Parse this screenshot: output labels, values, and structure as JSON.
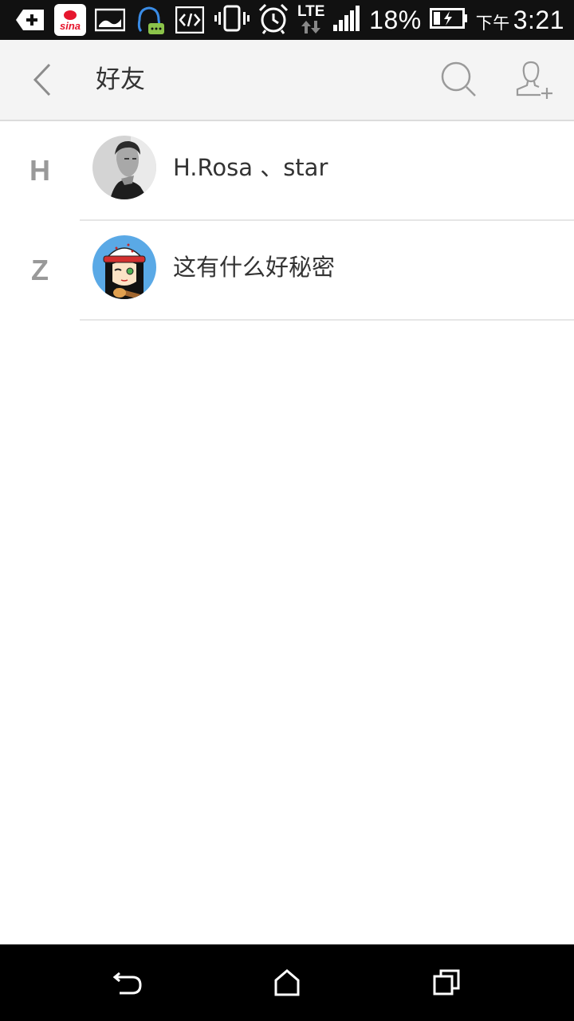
{
  "status_bar": {
    "notification_icons": [
      "add-icon",
      "sina-weibo-icon",
      "image-icon",
      "qq-chat-icon",
      "code-icon"
    ],
    "lte_label": "LTE",
    "battery_percent": "18%",
    "am_pm": "下午",
    "time": "3:21"
  },
  "header": {
    "title": "好友"
  },
  "friends": [
    {
      "index": "H",
      "name": "H.Rosa 、star"
    },
    {
      "index": "Z",
      "name": "这有什么好秘密"
    }
  ],
  "nav_bar": {
    "buttons": [
      "back-icon",
      "home-icon",
      "recent-apps-icon"
    ]
  }
}
